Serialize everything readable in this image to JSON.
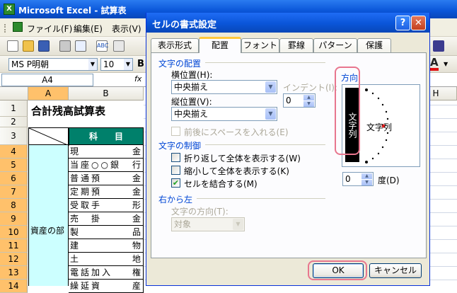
{
  "excel": {
    "title": "Microsoft Excel - 試算表",
    "app_icon": "X",
    "menu": [
      "ファイル(F)",
      "編集(E)",
      "表示(V)"
    ],
    "font_name": "MS P明朝",
    "font_size": "10",
    "bold_label": "B",
    "name_box": "A4",
    "fx_label": "fx",
    "columns": [
      "A",
      "B",
      "H"
    ],
    "title_cell": "合計残高試算表",
    "header_cell": "科　　目",
    "group_label": "資産の部",
    "rows": [
      "1",
      "2",
      "3",
      "4",
      "5",
      "6",
      "7",
      "8",
      "9",
      "10",
      "11",
      "12",
      "13",
      "14"
    ],
    "accounts": [
      {
        "l": "現",
        "r": "金"
      },
      {
        "l": "当座○○銀",
        "r": "行"
      },
      {
        "l": "普通預",
        "r": "金"
      },
      {
        "l": "定期預",
        "r": "金"
      },
      {
        "l": "受取手",
        "r": "形"
      },
      {
        "l": "売　掛",
        "r": "金"
      },
      {
        "l": "製",
        "r": "品"
      },
      {
        "l": "建",
        "r": "物"
      },
      {
        "l": "土",
        "r": "地"
      },
      {
        "l": "電話加入",
        "r": "権"
      },
      {
        "l": "繰延資",
        "r": "産"
      }
    ]
  },
  "dialog": {
    "title": "セルの書式設定",
    "help": "?",
    "close": "✕",
    "tabs": [
      "表示形式",
      "配置",
      "フォント",
      "罫線",
      "パターン",
      "保護"
    ],
    "active_tab": "配置",
    "text_alignment": {
      "group": "文字の配置",
      "horizontal_label": "横位置(H):",
      "horizontal_value": "中央揃え",
      "indent_label": "インデント(I):",
      "indent_value": "0",
      "vertical_label": "縦位置(V):",
      "vertical_value": "中央揃え",
      "space_label": "前後にスペースを入れる(E)"
    },
    "text_control": {
      "group": "文字の制御",
      "wrap_label": "折り返して全体を表示する(W)",
      "shrink_label": "縮小して全体を表示する(K)",
      "merge_label": "セルを結合する(M)",
      "merge_checked": true
    },
    "rtl": {
      "group": "右から左",
      "direction_label": "文字の方向(T):",
      "direction_value": "対象"
    },
    "orientation": {
      "group": "方向",
      "vertical_text": "文字列",
      "horizontal_text": "文字列",
      "degree_value": "0",
      "degree_label": "度(D)"
    },
    "ok_label": "OK",
    "cancel_label": "キャンセル"
  }
}
